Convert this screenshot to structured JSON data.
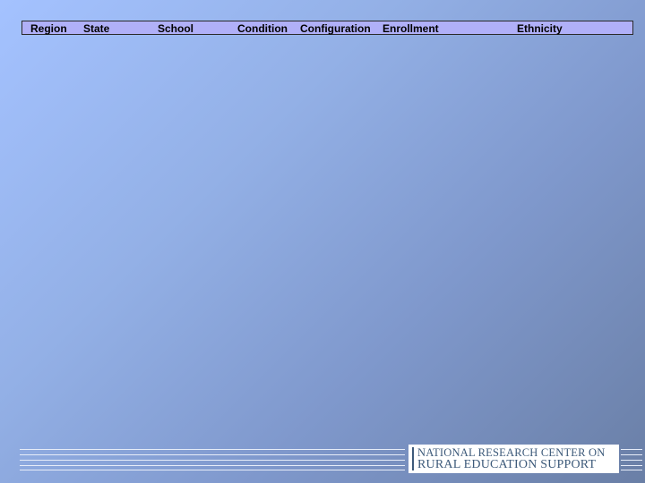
{
  "table_header": {
    "columns": [
      "Region",
      "State",
      "School",
      "Condition",
      "Configuration",
      "Enrollment",
      "Ethnicity"
    ]
  },
  "logo": {
    "line1": "NATIONAL RESEARCH CENTER ON",
    "line2": "RURAL EDUCATION SUPPORT"
  },
  "colors": {
    "header_bg": "#b0b0f8",
    "logo_text": "#3d5a7a"
  }
}
